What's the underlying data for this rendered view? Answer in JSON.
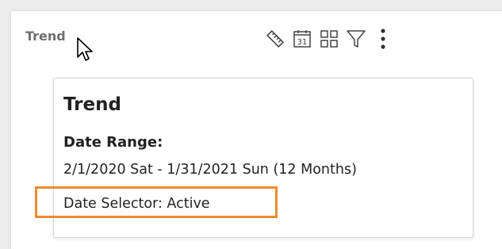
{
  "card": {
    "title": "Trend",
    "toolbar": [
      {
        "icon": "ruler-icon"
      },
      {
        "icon": "calendar-icon",
        "day": "31"
      },
      {
        "icon": "grid-icon"
      },
      {
        "icon": "filter-icon"
      },
      {
        "icon": "more-vertical-icon"
      }
    ]
  },
  "tooltip": {
    "title": "Trend",
    "date_range_label": "Date Range:",
    "date_range_value": "2/1/2020 Sat - 1/31/2021 Sun (12 Months)",
    "date_selector": "Date Selector: Active"
  },
  "colors": {
    "background": "#ececec",
    "highlight": "#ef8a2f",
    "title_gray": "#6e6e6e",
    "text": "#222222"
  }
}
